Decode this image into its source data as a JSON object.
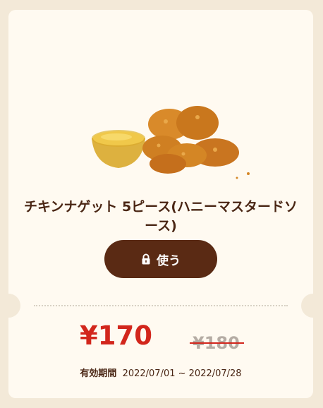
{
  "coupon": {
    "product_name": "チキンナゲット 5ピース(ハニーマスタードソース)",
    "use_button_label": "使う",
    "price": "¥170",
    "original_price": "¥180",
    "validity_label": "有効期間",
    "validity_dates": "2022/07/01 ~ 2022/07/28",
    "lock_icon": "lock-icon"
  },
  "colors": {
    "background": "#f3e9d8",
    "card": "#fffaf1",
    "button": "#5a2a14",
    "price_red": "#d2261c",
    "text_brown": "#4a2614"
  }
}
